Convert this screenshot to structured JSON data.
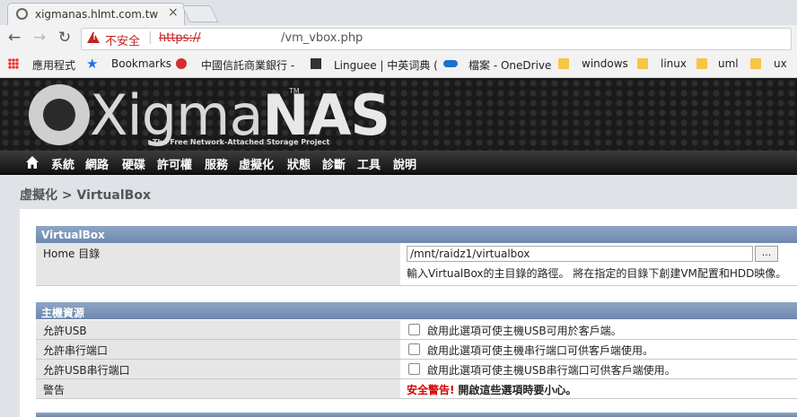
{
  "browser": {
    "tab_title": "xigmanas.hlmt.com.tw - ",
    "insecure_label": "不安全",
    "url_scheme": "https://",
    "url_path": "/vm_vbox.php",
    "bookmarks": [
      {
        "label": "應用程式"
      },
      {
        "label": "Bookmarks"
      },
      {
        "label": "中國信託商業銀行 -"
      },
      {
        "label": "Linguee | 中英词典 ("
      },
      {
        "label": "檔案 - OneDrive"
      },
      {
        "label": "windows"
      },
      {
        "label": "linux"
      },
      {
        "label": "uml"
      },
      {
        "label": "ux"
      }
    ]
  },
  "header": {
    "logo_prefix": "Xigma",
    "logo_suffix": "NAS",
    "logo_tm": "TM",
    "tagline": "The Free Network-Attached Storage Project"
  },
  "menu": [
    "系統",
    "網路",
    "硬碟",
    "許可權",
    "服務",
    "虛擬化",
    "狀態",
    "診斷",
    "工具",
    "說明"
  ],
  "page": {
    "title": "虛擬化 > VirtualBox",
    "section_vbox": "VirtualBox",
    "home_label": "Home 目錄",
    "home_value": "/mnt/raidz1/virtualbox",
    "browse_label": "...",
    "home_hint": "輸入VirtualBox的主目錄的路徑。 將在指定的目錄下創建VM配置和HDD映像。",
    "section_host": "主機資源",
    "rows": [
      {
        "label": "允許USB",
        "text": "啟用此選項可使主機USB可用於客戶端。"
      },
      {
        "label": "允許串行端口",
        "text": "啟用此選項可使主機串行端口可供客戶端使用。"
      },
      {
        "label": "允許USB串行端口",
        "text": "啟用此選項可使主機USB串行端口可供客戶端使用。"
      }
    ],
    "warning_label": "警告",
    "warning_red": "安全警告!",
    "warning_black": "開啟這些選項時要小心。"
  }
}
